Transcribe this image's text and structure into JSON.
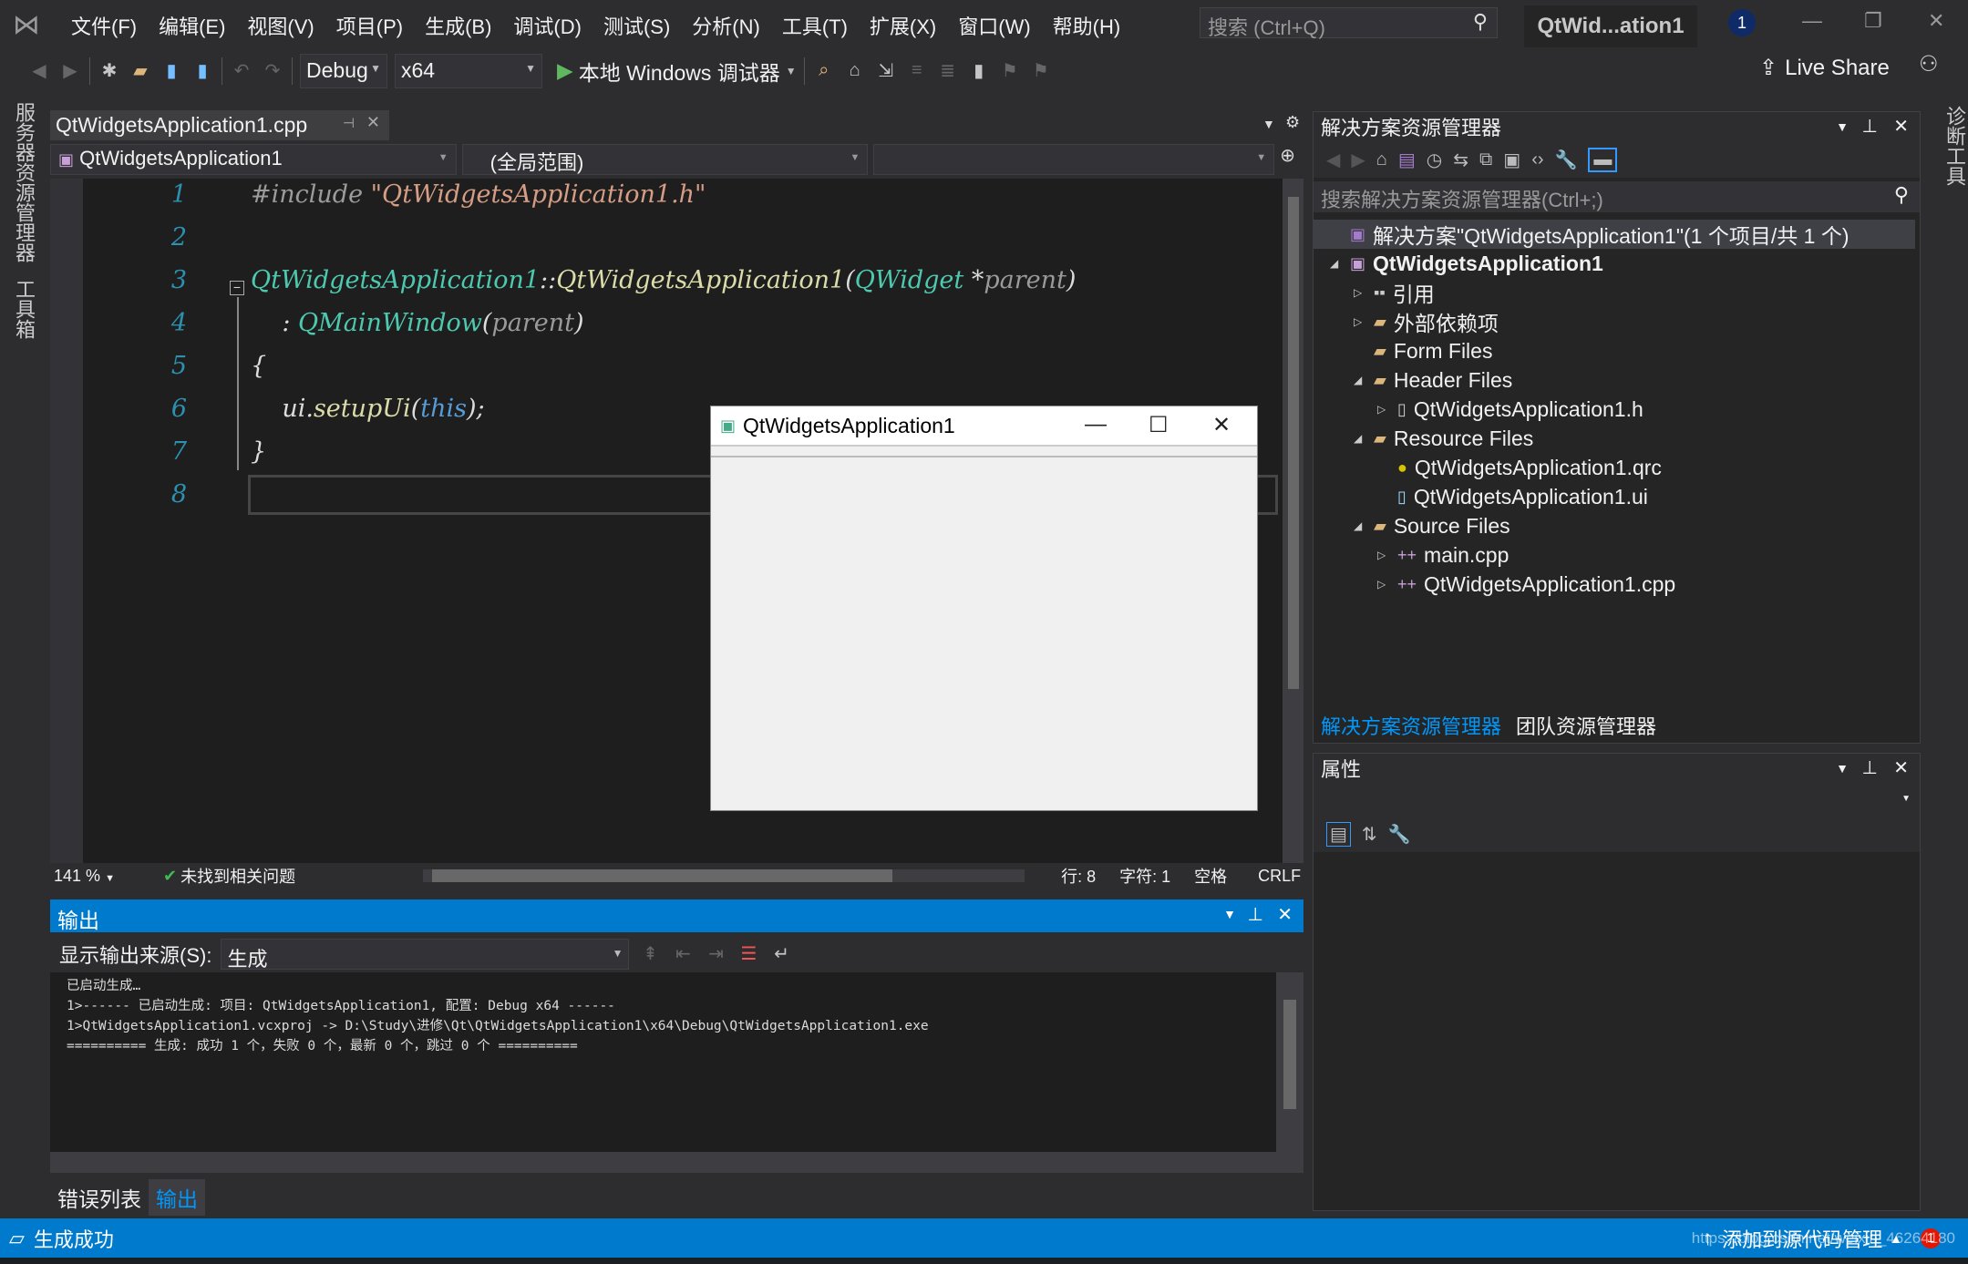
{
  "menu": {
    "items": [
      "文件(F)",
      "编辑(E)",
      "视图(V)",
      "项目(P)",
      "生成(B)",
      "调试(D)",
      "测试(S)",
      "分析(N)",
      "工具(T)",
      "扩展(X)",
      "窗口(W)",
      "帮助(H)"
    ],
    "search_placeholder": "搜索 (Ctrl+Q)",
    "window_title": "QtWid...ation1",
    "notification_count": "1"
  },
  "toolbar": {
    "config": "Debug",
    "platform": "x64",
    "run_label": "本地 Windows 调试器",
    "live_share": "Live Share"
  },
  "left_strip": {
    "server_explorer": "服务器资源管理器",
    "toolbox": "工具箱"
  },
  "right_strip": {
    "diagnostics": "诊断工具"
  },
  "editor": {
    "tab": "QtWidgetsApplication1.cpp",
    "nav_class": "QtWidgetsApplication1",
    "nav_scope": "(全局范围)",
    "nav_member": "",
    "lines": [
      {
        "n": "1",
        "tokens": [
          [
            "c-pre",
            "#include "
          ],
          [
            "c-str",
            "\"QtWidgetsApplication1.h\""
          ]
        ]
      },
      {
        "n": "2",
        "tokens": []
      },
      {
        "n": "3",
        "tokens": [
          [
            "c-cls",
            "QtWidgetsApplication1"
          ],
          [
            "c-pl",
            "::"
          ],
          [
            "c-fn",
            "QtWidgetsApplication1"
          ],
          [
            "c-pl",
            "("
          ],
          [
            "c-cls",
            "QWidget"
          ],
          [
            "c-pl",
            " *"
          ],
          [
            "c-par",
            "parent"
          ],
          [
            "c-pl",
            ")"
          ]
        ]
      },
      {
        "n": "4",
        "tokens": [
          [
            "c-pl",
            "    : "
          ],
          [
            "c-cls",
            "QMainWindow"
          ],
          [
            "c-pl",
            "("
          ],
          [
            "c-par",
            "parent"
          ],
          [
            "c-pl",
            ")"
          ]
        ]
      },
      {
        "n": "5",
        "tokens": [
          [
            "c-pl",
            "{"
          ]
        ]
      },
      {
        "n": "6",
        "tokens": [
          [
            "c-pl",
            "    ui."
          ],
          [
            "c-fn",
            "setupUi"
          ],
          [
            "c-pl",
            "("
          ],
          [
            "c-kw",
            "this"
          ],
          [
            "c-pl",
            ");"
          ]
        ]
      },
      {
        "n": "7",
        "tokens": [
          [
            "c-pl",
            "}"
          ]
        ]
      },
      {
        "n": "8",
        "tokens": []
      }
    ],
    "status": {
      "zoom": "141 %",
      "issues": "未找到相关问题",
      "line": "行: 8",
      "char": "字符: 1",
      "spaces": "空格",
      "eol": "CRLF"
    }
  },
  "qt_window": {
    "title": "QtWidgetsApplication1"
  },
  "output": {
    "title": "输出",
    "source_label": "显示输出来源(S):",
    "source_value": "生成",
    "lines": [
      "已启动生成…",
      "1>------ 已启动生成: 项目: QtWidgetsApplication1, 配置: Debug x64 ------",
      "1>QtWidgetsApplication1.vcxproj -> D:\\Study\\进修\\Qt\\QtWidgetsApplication1\\x64\\Debug\\QtWidgetsApplication1.exe",
      "========== 生成: 成功 1 个，失败 0 个，最新 0 个，跳过 0 个 =========="
    ],
    "tabs": [
      "错误列表",
      "输出"
    ]
  },
  "solution_explorer": {
    "title": "解决方案资源管理器",
    "search_placeholder": "搜索解决方案资源管理器(Ctrl+;)",
    "tree": [
      {
        "label": "解决方案\"QtWidgetsApplication1\"(1 个项目/共 1 个)",
        "level": 0,
        "expander": "",
        "icon": "solution-icon"
      },
      {
        "label": "QtWidgetsApplication1",
        "level": 0,
        "expander": "◢",
        "icon": "project-icon",
        "bold": true
      },
      {
        "label": "引用",
        "level": 1,
        "expander": "▷",
        "icon": "references-icon"
      },
      {
        "label": "外部依赖项",
        "level": 1,
        "expander": "▷",
        "icon": "folder-icon"
      },
      {
        "label": "Form Files",
        "level": 1,
        "expander": "",
        "icon": "folder-icon"
      },
      {
        "label": "Header Files",
        "level": 1,
        "expander": "◢",
        "icon": "folder-icon"
      },
      {
        "label": "QtWidgetsApplication1.h",
        "level": 2,
        "expander": "▷",
        "icon": "header-file-icon"
      },
      {
        "label": "Resource Files",
        "level": 1,
        "expander": "◢",
        "icon": "folder-icon"
      },
      {
        "label": "QtWidgetsApplication1.qrc",
        "level": 2,
        "expander": "",
        "icon": "qrc-file-icon"
      },
      {
        "label": "QtWidgetsApplication1.ui",
        "level": 2,
        "expander": "",
        "icon": "ui-file-icon"
      },
      {
        "label": "Source Files",
        "level": 1,
        "expander": "◢",
        "icon": "folder-icon"
      },
      {
        "label": "main.cpp",
        "level": 2,
        "expander": "▷",
        "icon": "cpp-file-icon"
      },
      {
        "label": "QtWidgetsApplication1.cpp",
        "level": 2,
        "expander": "▷",
        "icon": "cpp-file-icon"
      }
    ],
    "tabs": [
      "解决方案资源管理器",
      "团队资源管理器"
    ]
  },
  "properties": {
    "title": "属性"
  },
  "statusbar": {
    "message": "生成成功",
    "source_control": "添加到源代码管理",
    "notifications": "1",
    "watermark": "https://blog.csdn.net/weixin_46264180"
  },
  "colors": {
    "accent": "#007acc",
    "background": "#2d2d30",
    "editor": "#1e1e1e"
  }
}
